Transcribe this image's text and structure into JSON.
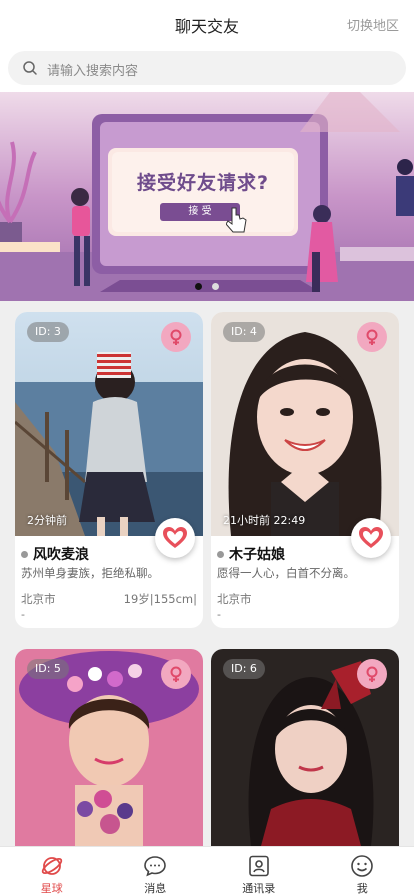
{
  "header": {
    "title": "聊天交友",
    "switch_label": "切换地区"
  },
  "search": {
    "placeholder": "请输入搜索内容"
  },
  "banner": {
    "headline": "接受好友请求?",
    "button_label": "接  受",
    "slides": 2,
    "active_slide": 0
  },
  "cards": [
    {
      "id": "ID: 3",
      "time": "2分钟前",
      "name": "风吹麦浪",
      "signature": "苏州单身妻族，拒绝私聊。",
      "city": "北京市",
      "info": "19岁|155cm|",
      "extra": "-"
    },
    {
      "id": "ID: 4",
      "time": "21小时前 22:49",
      "name": "木子姑娘",
      "signature": "愿得一人心，白首不分离。",
      "city": "北京市",
      "info": "",
      "extra": "-"
    },
    {
      "id": "ID: 5"
    },
    {
      "id": "ID: 6"
    }
  ],
  "tabbar": {
    "items": [
      {
        "label": "星球",
        "icon": "planet-icon",
        "active": true
      },
      {
        "label": "消息",
        "icon": "message-icon",
        "active": false
      },
      {
        "label": "通讯录",
        "icon": "contacts-icon",
        "active": false
      },
      {
        "label": "我",
        "icon": "smile-icon",
        "active": false
      }
    ]
  },
  "colors": {
    "accent": "#e04a4a",
    "gender_badge": "#f2a8c0",
    "heart": "#e8505b"
  }
}
